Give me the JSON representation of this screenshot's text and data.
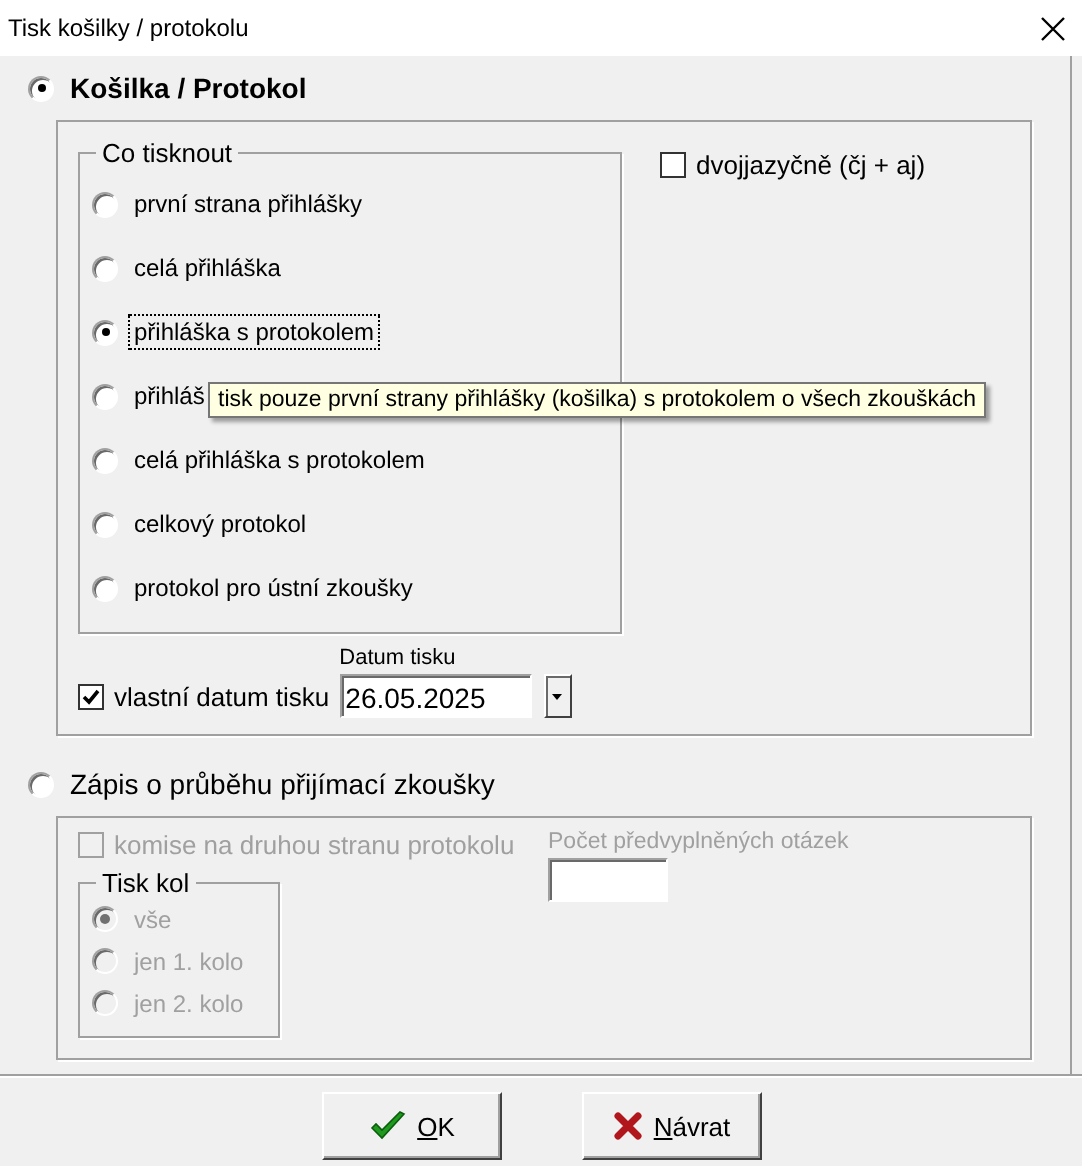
{
  "window": {
    "title": "Tisk košilky / protokolu"
  },
  "sections": [
    {
      "kind": "shirt",
      "label": "Košilka / Protokol",
      "selected": true,
      "what_to_print": {
        "title": "Co tisknout",
        "options": [
          {
            "label": "první strana přihlášky",
            "selected": false
          },
          {
            "label": "celá přihláška",
            "selected": false
          },
          {
            "label": "přihláška s protokolem",
            "selected": true
          },
          {
            "label": "přihláš",
            "selected": false
          },
          {
            "label": "celá přihláška s protokolem",
            "selected": false
          },
          {
            "label": "celkový protokol",
            "selected": false
          },
          {
            "label": "protokol pro ústní zkoušky",
            "selected": false
          }
        ]
      },
      "tooltip": {
        "text": "tisk pouze první strany přihlášky (košilka) s protokolem o všech zkouškách"
      },
      "bilingual": {
        "label": "dvojjazyčně (čj + aj)",
        "checked": false
      },
      "custom_date": {
        "label": "vlastní datum tisku",
        "checked": true
      },
      "date_field": {
        "label": "Datum tisku",
        "value": "26.05.2025"
      }
    },
    {
      "kind": "record",
      "label": "Zápis o průběhu přijímací zkoušky",
      "selected": false,
      "committee": {
        "label": "komise na druhou stranu protokolu",
        "checked": false,
        "disabled": true
      },
      "rounds": {
        "title": "Tisk kol",
        "options": [
          {
            "label": "vše",
            "selected": true,
            "disabled": true
          },
          {
            "label": "jen 1. kolo",
            "selected": false,
            "disabled": true
          },
          {
            "label": "jen 2. kolo",
            "selected": false,
            "disabled": true
          }
        ]
      },
      "question_count": {
        "label": "Počet předvyplněných otázek",
        "disabled": true
      }
    }
  ],
  "buttons": [
    {
      "kind": "ok",
      "label": "OK"
    },
    {
      "kind": "cancel",
      "label": "Návrat"
    }
  ]
}
